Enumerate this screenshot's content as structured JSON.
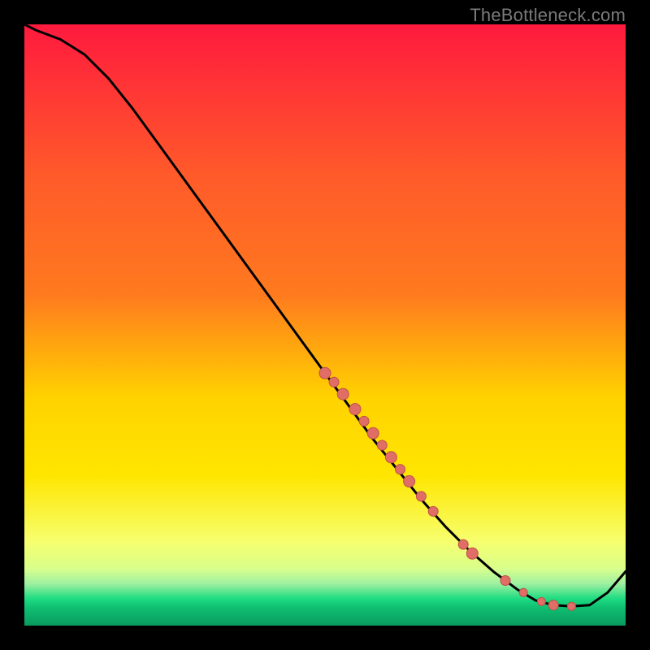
{
  "watermark": "TheBottleneck.com",
  "colors": {
    "background": "#000000",
    "gradient_top": "#ff1a3e",
    "gradient_mid1": "#ff7a1e",
    "gradient_mid2": "#ffe600",
    "gradient_low": "#f7ff6e",
    "gradient_green": "#1edc82",
    "line": "#000000",
    "dot_fill": "#e06e66",
    "dot_stroke": "#c05048"
  },
  "chart_data": {
    "type": "line",
    "title": "",
    "xlabel": "",
    "ylabel": "",
    "xlim": [
      0,
      100
    ],
    "ylim": [
      0,
      100
    ],
    "series": [
      {
        "name": "curve",
        "x": [
          0,
          2,
          6,
          10,
          14,
          18,
          22,
          26,
          30,
          34,
          38,
          42,
          46,
          50,
          54,
          58,
          62,
          66,
          70,
          74,
          78,
          82,
          85,
          88,
          91,
          94,
          97,
          100
        ],
        "y": [
          100,
          99,
          97.5,
          95,
          91,
          86,
          80.5,
          75,
          69.5,
          64,
          58.5,
          53,
          47.5,
          42,
          36.5,
          31,
          26,
          21,
          16.5,
          12.5,
          9,
          6,
          4.2,
          3.4,
          3.2,
          3.4,
          5.5,
          9
        ]
      }
    ],
    "scatter": [
      {
        "x": 50,
        "y": 42,
        "r": 7
      },
      {
        "x": 51.5,
        "y": 40.5,
        "r": 6
      },
      {
        "x": 53,
        "y": 38.5,
        "r": 7
      },
      {
        "x": 55,
        "y": 36,
        "r": 7
      },
      {
        "x": 56.5,
        "y": 34,
        "r": 6
      },
      {
        "x": 58,
        "y": 32,
        "r": 7
      },
      {
        "x": 59.5,
        "y": 30,
        "r": 6
      },
      {
        "x": 61,
        "y": 28,
        "r": 7
      },
      {
        "x": 62.5,
        "y": 26,
        "r": 6
      },
      {
        "x": 64,
        "y": 24,
        "r": 7
      },
      {
        "x": 66,
        "y": 21.5,
        "r": 6
      },
      {
        "x": 68,
        "y": 19,
        "r": 6
      },
      {
        "x": 73,
        "y": 13.5,
        "r": 6
      },
      {
        "x": 74.5,
        "y": 12,
        "r": 7
      },
      {
        "x": 80,
        "y": 7.5,
        "r": 6
      },
      {
        "x": 83,
        "y": 5.5,
        "r": 5
      },
      {
        "x": 86,
        "y": 4,
        "r": 5
      },
      {
        "x": 88,
        "y": 3.4,
        "r": 6
      },
      {
        "x": 91,
        "y": 3.2,
        "r": 5
      }
    ],
    "green_band": {
      "y_top": 6.5,
      "y_bottom": 3.2
    }
  }
}
